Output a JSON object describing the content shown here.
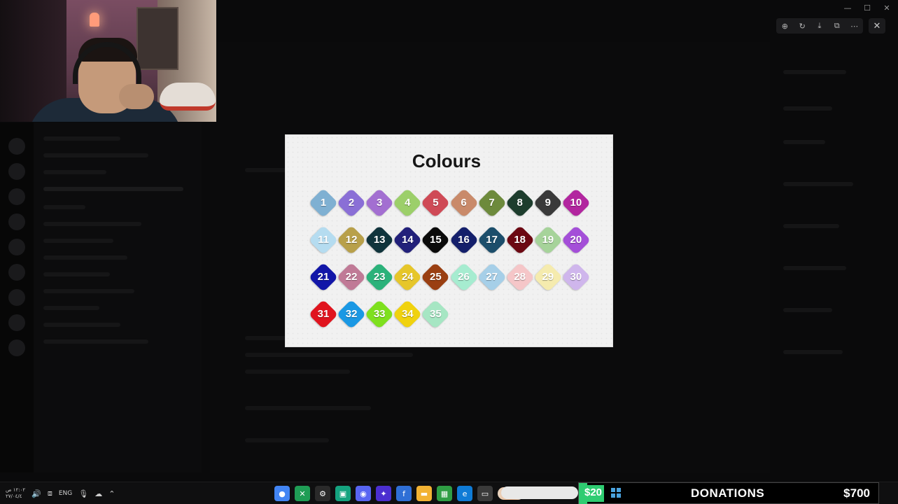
{
  "card": {
    "title": "Colours",
    "swatches": [
      {
        "n": "1",
        "color": "#7fb0d2"
      },
      {
        "n": "2",
        "color": "#8a6fd6"
      },
      {
        "n": "3",
        "color": "#a36fd1"
      },
      {
        "n": "4",
        "color": "#9ccf6a"
      },
      {
        "n": "5",
        "color": "#cf4a56"
      },
      {
        "n": "6",
        "color": "#c98a6a"
      },
      {
        "n": "7",
        "color": "#6d8a3c"
      },
      {
        "n": "8",
        "color": "#1d3d2d"
      },
      {
        "n": "9",
        "color": "#3a3a3a"
      },
      {
        "n": "10",
        "color": "#b2269f"
      },
      {
        "n": "11",
        "color": "#b5dcf0"
      },
      {
        "n": "12",
        "color": "#b8a04a"
      },
      {
        "n": "13",
        "color": "#10343c"
      },
      {
        "n": "14",
        "color": "#22207a"
      },
      {
        "n": "15",
        "color": "#0a0a0a"
      },
      {
        "n": "16",
        "color": "#141f6b"
      },
      {
        "n": "17",
        "color": "#1c4e6b"
      },
      {
        "n": "18",
        "color": "#6c0812"
      },
      {
        "n": "19",
        "color": "#a6d39a"
      },
      {
        "n": "20",
        "color": "#a44fd8"
      },
      {
        "n": "21",
        "color": "#1216a8"
      },
      {
        "n": "22",
        "color": "#c07a96"
      },
      {
        "n": "23",
        "color": "#2bb27a"
      },
      {
        "n": "24",
        "color": "#e6c62a"
      },
      {
        "n": "25",
        "color": "#9a3f12"
      },
      {
        "n": "26",
        "color": "#a6ecd0"
      },
      {
        "n": "27",
        "color": "#a6cfe8"
      },
      {
        "n": "28",
        "color": "#f5c6c8"
      },
      {
        "n": "29",
        "color": "#f5ebae"
      },
      {
        "n": "30",
        "color": "#cfb6ec"
      },
      {
        "n": "31",
        "color": "#e0141e"
      },
      {
        "n": "32",
        "color": "#1a98e4"
      },
      {
        "n": "33",
        "color": "#7ee01e"
      },
      {
        "n": "34",
        "color": "#f0d20e"
      },
      {
        "n": "35",
        "color": "#a6e6c3"
      }
    ]
  },
  "viewer": {
    "toolbar": [
      {
        "name": "zoom-in-icon",
        "glyph": "⊕"
      },
      {
        "name": "rotate-icon",
        "glyph": "↻"
      },
      {
        "name": "download-icon",
        "glyph": "⤓"
      },
      {
        "name": "open-external-icon",
        "glyph": "⧉"
      },
      {
        "name": "more-icon",
        "glyph": "⋯"
      }
    ],
    "close_glyph": "✕"
  },
  "window_controls": {
    "minimize": "—",
    "maximize": "☐",
    "close": "✕"
  },
  "taskbar": {
    "time": "١٢:٠٢ ص",
    "date": "٢٧/٠٤/٤",
    "language": "ENG"
  },
  "donations": {
    "current": "$20",
    "label": "DONATIONS",
    "goal": "$700",
    "progress": 0.029,
    "bar_color": "#2ecc71"
  }
}
